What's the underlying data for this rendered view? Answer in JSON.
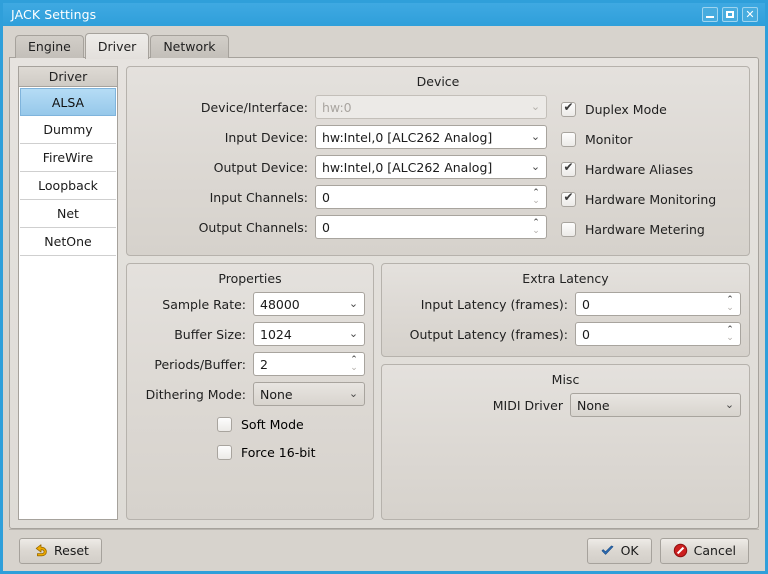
{
  "window": {
    "title": "JACK Settings",
    "minimize_label": "Minimize",
    "maximize_label": "Maximize",
    "close_label": "✕",
    "titlebar_color": "#2f9fda"
  },
  "tabs": [
    {
      "label": "Engine",
      "active": false
    },
    {
      "label": "Driver",
      "active": true
    },
    {
      "label": "Network",
      "active": false
    }
  ],
  "driver_list": {
    "header": "Driver",
    "selected": "ALSA",
    "selection_color": "#a8d4f0",
    "items": [
      {
        "label": "ALSA"
      },
      {
        "label": "Dummy"
      },
      {
        "label": "FireWire"
      },
      {
        "label": "Loopback"
      },
      {
        "label": "Net"
      },
      {
        "label": "NetOne"
      }
    ]
  },
  "device": {
    "title": "Device",
    "fields": [
      {
        "label": "Device/Interface:",
        "value": "hw:0",
        "type": "combo",
        "disabled": true
      },
      {
        "label": "Input Device:",
        "value": "hw:Intel,0 [ALC262 Analog]",
        "type": "combo",
        "disabled": false
      },
      {
        "label": "Output Device:",
        "value": "hw:Intel,0 [ALC262 Analog]",
        "type": "combo",
        "disabled": false
      },
      {
        "label": "Input Channels:",
        "value": "0",
        "type": "spin",
        "disabled": false
      },
      {
        "label": "Output Channels:",
        "value": "0",
        "type": "spin",
        "disabled": false
      }
    ],
    "checkboxes": [
      {
        "label": "Duplex Mode",
        "checked": true
      },
      {
        "label": "Monitor",
        "checked": false
      },
      {
        "label": "Hardware Aliases",
        "checked": true
      },
      {
        "label": "Hardware Monitoring",
        "checked": true
      },
      {
        "label": "Hardware Metering",
        "checked": false
      }
    ]
  },
  "properties": {
    "title": "Properties",
    "fields": [
      {
        "label": "Sample Rate:",
        "value": "48000",
        "type": "combo",
        "flat": false
      },
      {
        "label": "Buffer Size:",
        "value": "1024",
        "type": "combo",
        "flat": false
      },
      {
        "label": "Periods/Buffer:",
        "value": "2",
        "type": "spin",
        "flat": false
      },
      {
        "label": "Dithering Mode:",
        "value": "None",
        "type": "combo",
        "flat": true
      }
    ],
    "checkboxes": [
      {
        "label": "Soft Mode",
        "checked": false
      },
      {
        "label": "Force 16-bit",
        "checked": false
      }
    ]
  },
  "extra_latency": {
    "title": "Extra Latency",
    "fields": [
      {
        "label": "Input Latency (frames):",
        "value": "0",
        "type": "spin"
      },
      {
        "label": "Output Latency (frames):",
        "value": "0",
        "type": "spin"
      }
    ]
  },
  "misc": {
    "title": "Misc",
    "fields": [
      {
        "label": "MIDI Driver",
        "value": "None",
        "type": "combo",
        "flat": true
      }
    ]
  },
  "buttons": {
    "reset": "Reset",
    "ok": "OK",
    "cancel": "Cancel"
  }
}
